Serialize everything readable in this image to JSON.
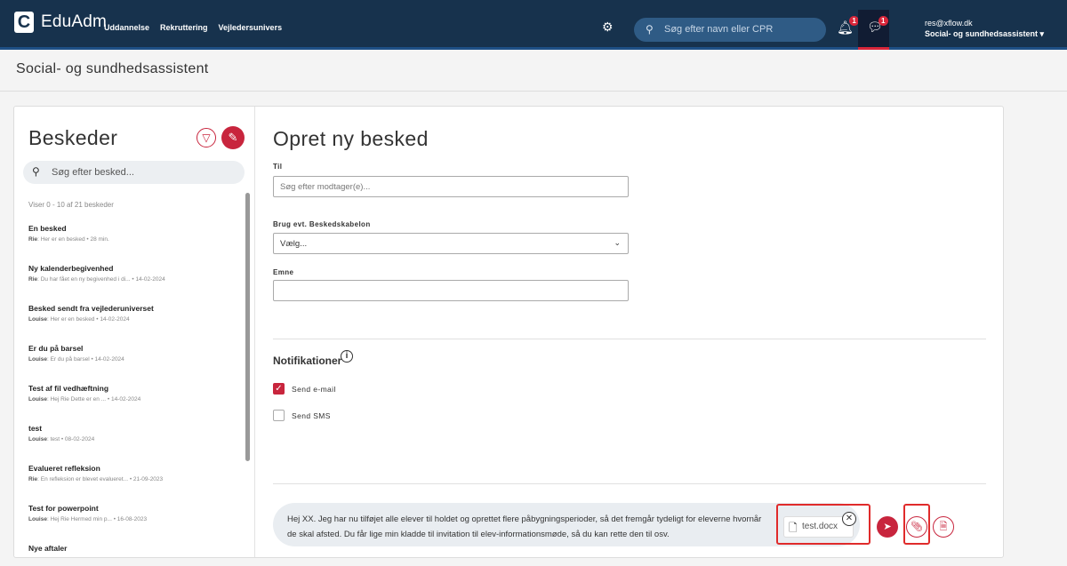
{
  "topbar": {
    "brand": "EduAdm",
    "nav": [
      "Uddannelse",
      "Rekruttering",
      "Vejledersunivers"
    ],
    "search_placeholder": "Søg efter navn eller CPR",
    "notifications_count": "1",
    "messages_count": "1",
    "user_email": "res@xflow.dk",
    "user_role": "Social- og sundhedsassistent"
  },
  "page": {
    "title": "Social- og sundhedsassistent"
  },
  "messages": {
    "title": "Beskeder",
    "search_placeholder": "Søg efter besked...",
    "count_text": "Viser 0 - 10 af 21 beskeder",
    "items": [
      {
        "title": "En besked",
        "sender": "Rie",
        "preview": ": Her er en besked • 28 min."
      },
      {
        "title": "Ny kalenderbegivenhed",
        "sender": "Rie",
        "preview": ": Du har fået en ny begivenhed i di... • 14-02-2024"
      },
      {
        "title": "Besked sendt fra vejlederuniverset",
        "sender": "Louise",
        "preview": ": Her er en besked • 14-02-2024"
      },
      {
        "title": "Er du på barsel",
        "sender": "Louise",
        "preview": ": Er du på barsel • 14-02-2024"
      },
      {
        "title": "Test af fil vedhæftning",
        "sender": "Louise",
        "preview": ": Hej Rie Dette er en ... • 14-02-2024"
      },
      {
        "title": "test",
        "sender": "Louise",
        "preview": ": test • 08-02-2024"
      },
      {
        "title": "Evalueret refleksion",
        "sender": "Rie",
        "preview": ": En refleksion er blevet evalueret... • 21-09-2023"
      },
      {
        "title": "Test for powerpoint",
        "sender": "Louise",
        "preview": ": Hej Rie Hermed min p... • 16-08-2023"
      },
      {
        "title": "Nye aftaler",
        "sender": "",
        "preview": ""
      }
    ]
  },
  "form": {
    "title": "Opret ny besked",
    "to_label": "Til",
    "to_placeholder": "Søg efter modtager(e)...",
    "template_label": "Brug evt. Beskedskabelon",
    "template_value": "Vælg...",
    "subject_label": "Emne",
    "subject_value": "",
    "notifications_title": "Notifikationer",
    "send_email_label": "Send e-mail",
    "send_sms_label": "Send SMS",
    "body_text": "Hej XX. Jeg har nu tilføjet alle elever til holdet og oprettet flere påbygningsperioder, så det fremgår tydeligt for eleverne hvornår de skal afsted. Du får lige min kladde til invitation til elev-informationsmøde, så du kan rette den til osv.",
    "attachment_name": "test.docx"
  }
}
